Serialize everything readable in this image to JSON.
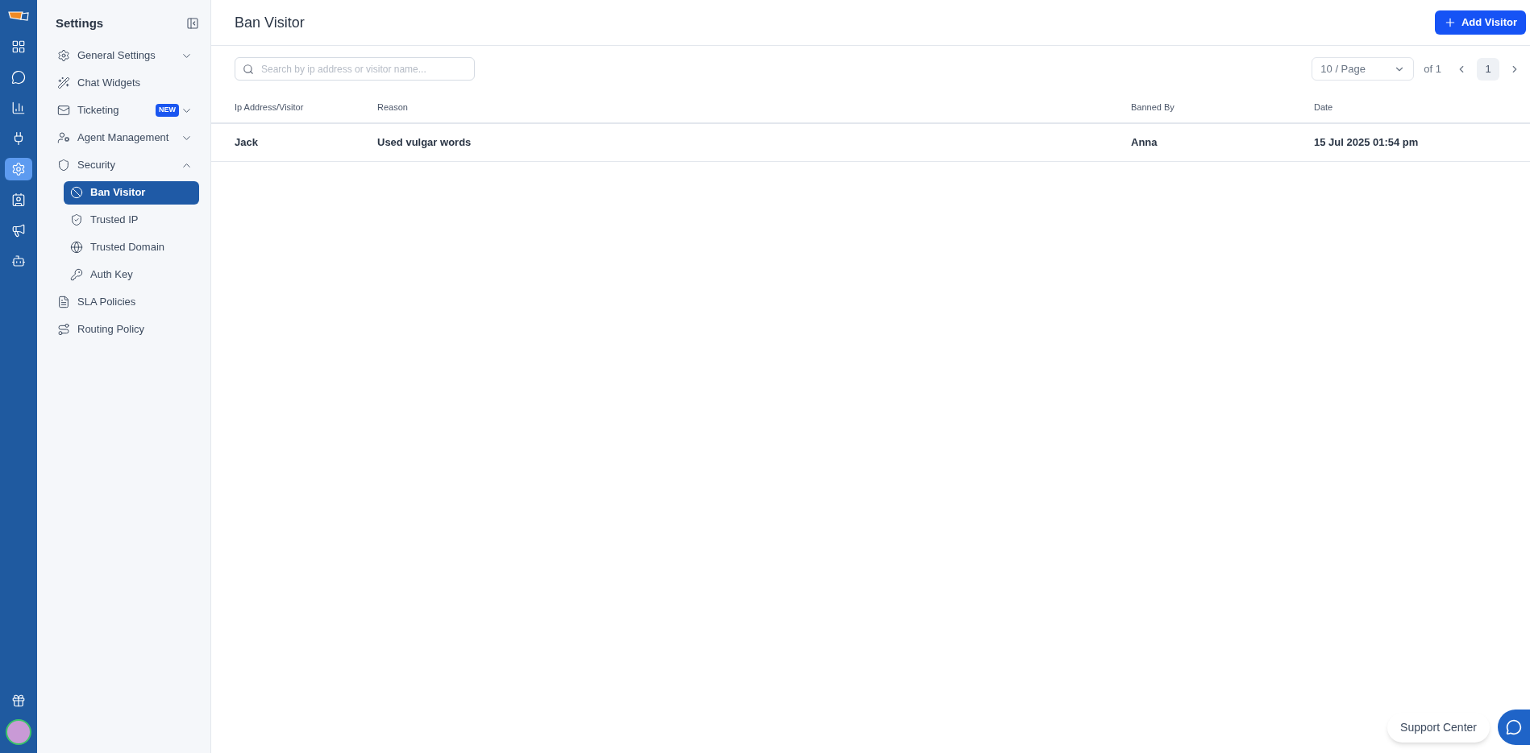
{
  "rail": {
    "items": [
      {
        "kind": "grid",
        "selected": false
      },
      {
        "kind": "chat",
        "selected": false
      },
      {
        "kind": "chart",
        "selected": false
      },
      {
        "kind": "plug",
        "selected": false
      },
      {
        "kind": "gear",
        "selected": true
      },
      {
        "kind": "contacts",
        "selected": false
      },
      {
        "kind": "megaphone",
        "selected": false
      },
      {
        "kind": "bot",
        "selected": false
      }
    ]
  },
  "sidebar": {
    "title": "Settings",
    "items": [
      {
        "label": "General Settings",
        "kind": "gear",
        "expanded": false,
        "selected": false
      },
      {
        "label": "Chat Widgets",
        "kind": "wand",
        "selected": false
      },
      {
        "label": "Ticketing",
        "kind": "mail",
        "badge": "NEW",
        "expanded": false,
        "selected": false
      },
      {
        "label": "Agent Management",
        "kind": "user-gear",
        "expanded": false,
        "selected": false
      },
      {
        "label": "Security",
        "kind": "shield",
        "expanded": true,
        "selected": false,
        "children": [
          {
            "label": "Ban Visitor",
            "kind": "ban",
            "selected": true
          },
          {
            "label": "Trusted IP",
            "kind": "shield-check",
            "selected": false
          },
          {
            "label": "Trusted Domain",
            "kind": "globe",
            "selected": false
          },
          {
            "label": "Auth Key",
            "kind": "key",
            "selected": false
          }
        ]
      },
      {
        "label": "SLA Policies",
        "kind": "file",
        "selected": false
      },
      {
        "label": "Routing Policy",
        "kind": "route",
        "selected": false
      }
    ]
  },
  "header": {
    "title": "Ban Visitor",
    "button": "Add Visitor"
  },
  "search": {
    "placeholder": "Search by ip address or visitor name..."
  },
  "pagination": {
    "page_size": "10 / Page",
    "of": "of 1",
    "pages": [
      {
        "label": "1",
        "selected": true
      }
    ]
  },
  "table": {
    "columns": [
      "Ip Address/Visitor",
      "Reason",
      "Banned By",
      "Date"
    ],
    "rows": [
      [
        "Jack",
        "Used vulgar words",
        "Anna",
        "15 Jul 2025 01:54 pm"
      ]
    ]
  },
  "support": {
    "label": "Support Center"
  }
}
